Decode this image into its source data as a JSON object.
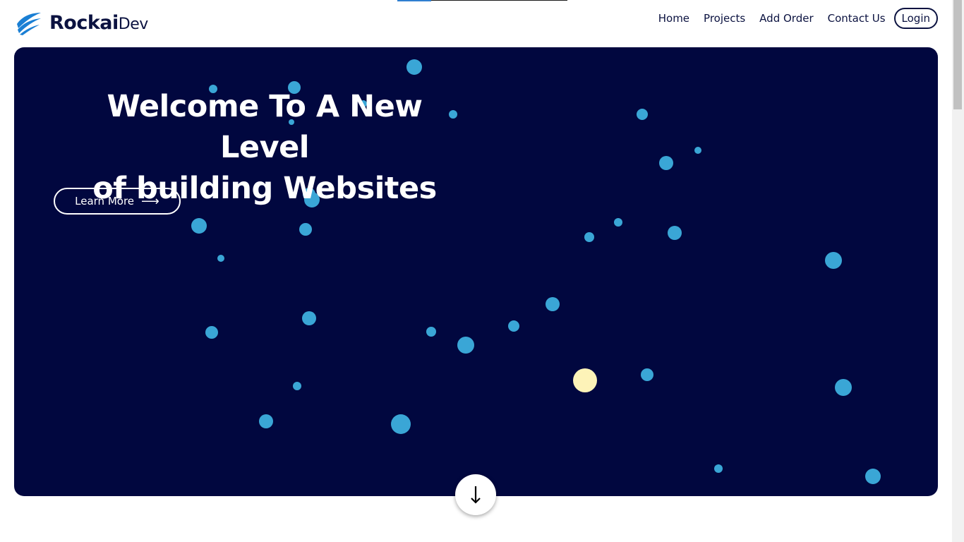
{
  "brand": {
    "name": "Rockai",
    "suffix": "Dev",
    "icon": "wing-logo-icon"
  },
  "nav": {
    "items": [
      "Home",
      "Projects",
      "Add Order",
      "Contact Us"
    ],
    "login_label": "Login"
  },
  "hero": {
    "title_line1": "Welcome To A New Level",
    "title_line2": "of building Websites",
    "cta_label": "Learn More",
    "cta_icon": "arrow-right-icon"
  },
  "scroll_button": {
    "icon": "arrow-down-icon"
  },
  "colors": {
    "hero_bg": "#01073f",
    "dot": "#3aa6d6",
    "highlight_dot": "#fdf3b8",
    "text_dark": "#0b1240",
    "brand_blue": "#1a7fd4"
  }
}
